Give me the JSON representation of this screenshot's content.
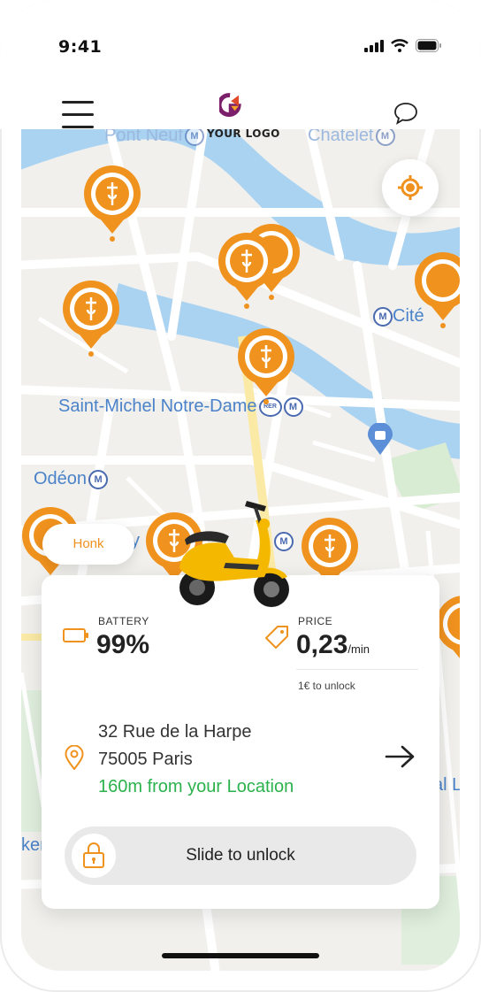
{
  "status_bar": {
    "time": "9:41"
  },
  "header": {
    "logo_text": "YOUR LOGO"
  },
  "map": {
    "labels": {
      "pont_neuf": "Pont Neuf",
      "chatelet": "Chatelet",
      "cite": "Cité",
      "saint_michel": "Saint-Michel Notre-Dame",
      "odeon": "Odéon",
      "partial_ker": "ker",
      "partial_al": "al L",
      "partial_y": "y"
    },
    "metro_letter": "M",
    "rer_badge": "RER"
  },
  "honk": {
    "label": "Honk"
  },
  "card": {
    "battery_label": "BATTERY",
    "battery_value": "99%",
    "price_label": "PRICE",
    "price_value": "0,23",
    "price_unit": "/min",
    "unlock_fee": "1€ to unlock",
    "address_line1": "32 Rue de la Harpe",
    "address_line2": "75005 Paris",
    "distance": "160m from your Location",
    "slide_label": "Slide to unlock"
  },
  "colors": {
    "accent": "#f0921e",
    "distance_green": "#2bb24c",
    "river": "#aad3f2",
    "map_bg": "#f1f0ec",
    "scooter_yellow": "#f5b800"
  },
  "icons": [
    "hamburger-menu-icon",
    "chat-icon",
    "locate-icon",
    "scooter-pin-icon",
    "battery-icon",
    "price-tag-icon",
    "location-pin-icon",
    "arrow-right-icon",
    "lock-icon"
  ]
}
